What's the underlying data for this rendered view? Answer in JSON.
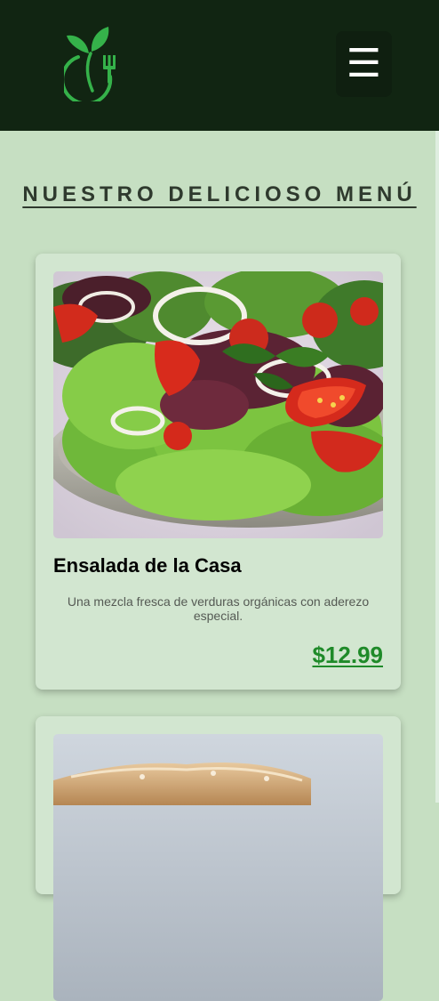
{
  "header": {
    "logo_icon": "leaf-fork-logo-icon",
    "menu_icon": "hamburger-icon",
    "menu_glyph": "☰",
    "colors": {
      "background": "#112512",
      "logo": "#35b24a"
    }
  },
  "page": {
    "title": "NUESTRO DELICIOSO MENÚ",
    "background": "#c6dfc2"
  },
  "menu_items": [
    {
      "name": "Ensalada de la Casa",
      "description": "Una mezcla fresca de verduras orgánicas con aderezo especial.",
      "price": "$12.99",
      "image": "salad-photo"
    },
    {
      "image": "bread-photo"
    }
  ]
}
